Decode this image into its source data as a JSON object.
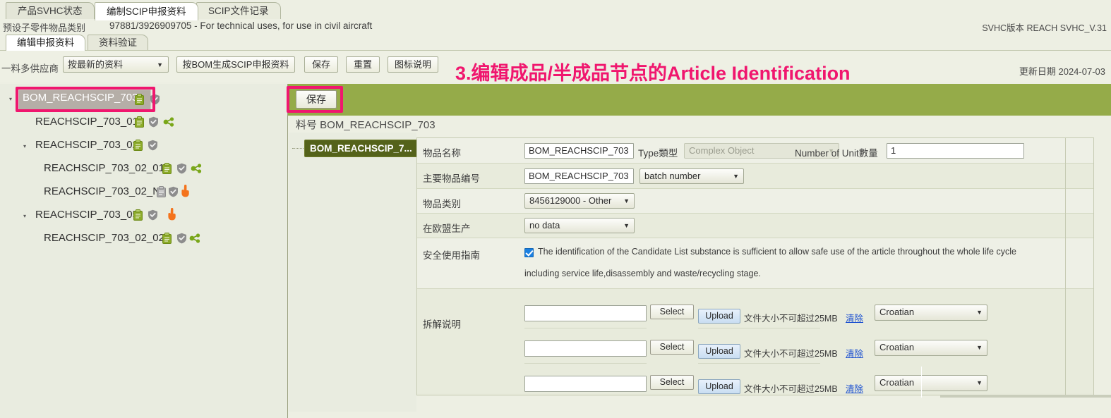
{
  "top_tabs": [
    {
      "label": "产品SVHC状态",
      "active": false
    },
    {
      "label": "编制SCIP申报资料",
      "active": true
    },
    {
      "label": "SCIP文件记录",
      "active": false
    }
  ],
  "preset_bar": {
    "label": "预设子零件物品类别",
    "value": "97881/3926909705 - For technical uses, for use in civil aircraft",
    "version": "SVHC版本 REACH SVHC_V.31"
  },
  "sub_tabs": [
    {
      "label": "编辑申报资料",
      "active": true
    },
    {
      "label": "资料验证",
      "active": false
    }
  ],
  "toolbar": {
    "supplier_label": "一料多供应商",
    "supplier_select_value": "按最新的资料",
    "generate_button": "按BOM生成SCIP申报资料",
    "save_button": "保存",
    "reset_button": "重置",
    "legend_button": "图标说明",
    "annotation": "3.编辑成品/半成品节点的Article Identification",
    "updated": "更新日期 2024-07-03"
  },
  "tree": {
    "nodes": [
      {
        "label": "BOM_REACHSCIP_703",
        "indent": 0,
        "arrow": "▾",
        "selected": true,
        "icons": [
          "clipboard-green",
          "shield-gray"
        ]
      },
      {
        "label": "REACHSCIP_703_01",
        "indent": 1,
        "arrow": "",
        "selected": false,
        "icons": [
          "clipboard-green",
          "shield-gray",
          "molecule-green"
        ]
      },
      {
        "label": "REACHSCIP_703_02",
        "indent": 1,
        "arrow": "▾",
        "selected": false,
        "icons": [
          "clipboard-green",
          "shield-gray"
        ]
      },
      {
        "label": "REACHSCIP_703_02_01",
        "indent": 2,
        "arrow": "",
        "selected": false,
        "icons": [
          "clipboard-green",
          "shield-gray",
          "molecule-green"
        ]
      },
      {
        "label": "REACHSCIP_703_02_N",
        "indent": 2,
        "arrow": "",
        "selected": false,
        "icons": [
          "clipboard-gray",
          "shield-gray",
          "hand-orange"
        ]
      },
      {
        "label": "REACHSCIP_703_05",
        "indent": 1,
        "arrow": "▾",
        "selected": false,
        "icons": [
          "clipboard-green",
          "shield-gray",
          "hand-orange"
        ]
      },
      {
        "label": "REACHSCIP_703_02_02",
        "indent": 2,
        "arrow": "",
        "selected": false,
        "icons": [
          "clipboard-green",
          "shield-gray",
          "molecule-green"
        ]
      }
    ]
  },
  "detail": {
    "save_button": "保存",
    "part_no": "料号 BOM_REACHSCIP_703",
    "mid_node": "BOM_REACHSCIP_7...",
    "fields": {
      "name_label": "物品名称",
      "name_value": "BOM_REACHSCIP_703",
      "type_label": "Type類型",
      "type_value": "Complex Object",
      "unit_label": "Number of Unit數量",
      "unit_value": "1",
      "primary_id_label": "主要物品编号",
      "primary_id_value": "BOM_REACHSCIP_703",
      "primary_id_type": "batch number",
      "category_label": "物品类别",
      "category_value": "8456129000 - Other",
      "eu_label": "在欧盟生产",
      "eu_value": "no data",
      "safe_label": "安全使用指南",
      "safe_text_line1": "The identification of the Candidate List substance is sufficient to allow safe use of the article throughout the whole life cycle",
      "safe_text_line2": "including service life,disassembly and waste/recycling stage.",
      "safe_checked": true,
      "disassembly_label": "拆解说明"
    },
    "uploads": [
      {
        "file_value": "",
        "select_button": "Select",
        "upload_button": "Upload",
        "hint": "文件大小不可超过25MB",
        "clear": "清除",
        "language": "Croatian"
      },
      {
        "file_value": "",
        "select_button": "Select",
        "upload_button": "Upload",
        "hint": "文件大小不可超过25MB",
        "clear": "清除",
        "language": "Croatian"
      },
      {
        "file_value": "",
        "select_button": "Select",
        "upload_button": "Upload",
        "hint": "文件大小不可超过25MB",
        "clear": "清除",
        "language": "Croatian"
      }
    ]
  },
  "colors": {
    "green_band": "#95ab49",
    "annotation_pink": "#f0166e",
    "node_olive": "#54621a",
    "panel_bg": "#e9ece0"
  }
}
